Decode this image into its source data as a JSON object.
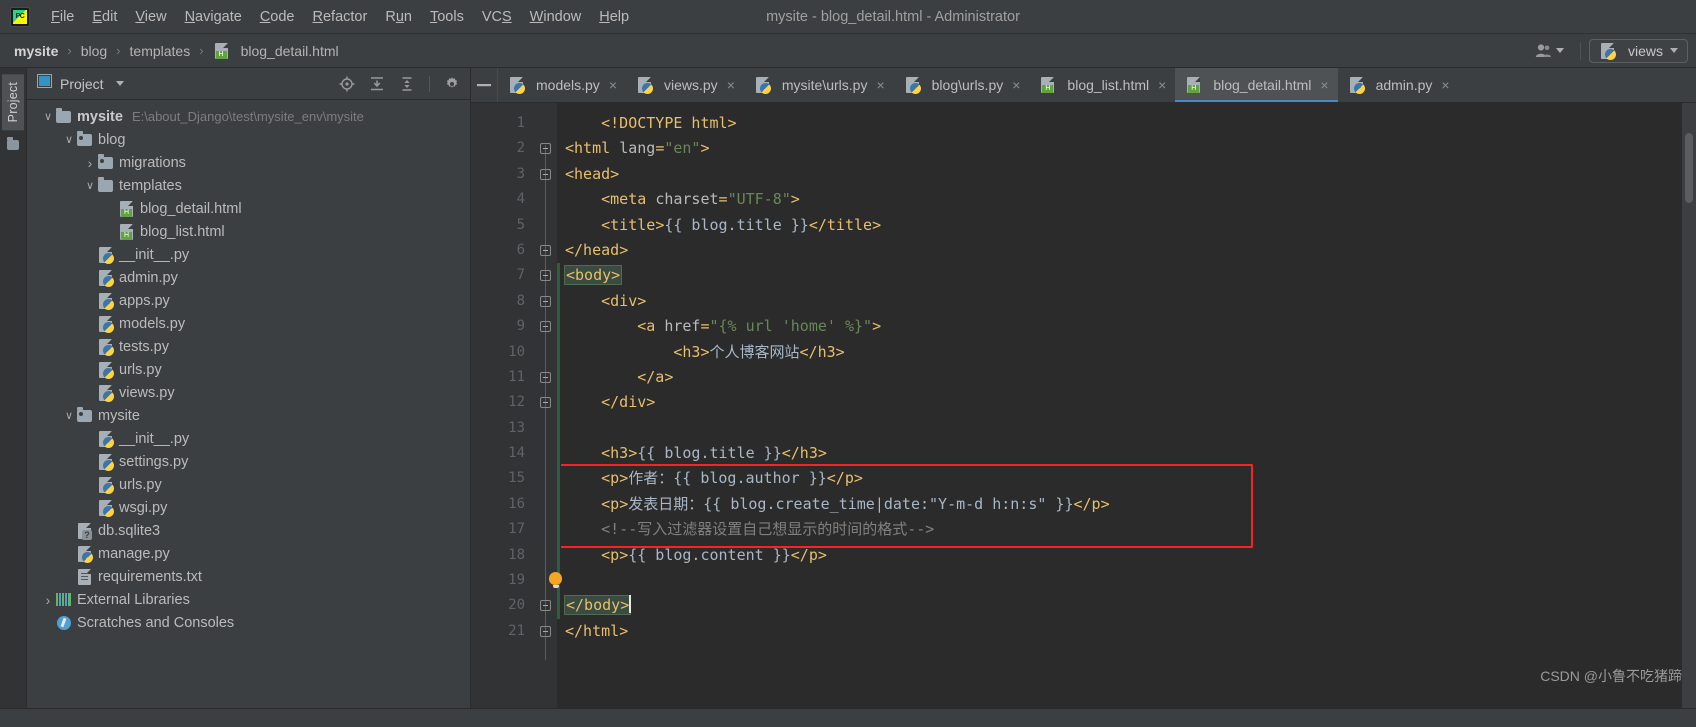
{
  "window": {
    "title": "mysite - blog_detail.html - Administrator",
    "logo_text": "PC"
  },
  "menu": {
    "items": [
      {
        "label": "File",
        "mnemonic": "F"
      },
      {
        "label": "Edit",
        "mnemonic": "E"
      },
      {
        "label": "View",
        "mnemonic": "V"
      },
      {
        "label": "Navigate",
        "mnemonic": "N"
      },
      {
        "label": "Code",
        "mnemonic": "C"
      },
      {
        "label": "Refactor",
        "mnemonic": "R"
      },
      {
        "label": "Run",
        "mnemonic": "u"
      },
      {
        "label": "Tools",
        "mnemonic": "T"
      },
      {
        "label": "VCS",
        "mnemonic": "S"
      },
      {
        "label": "Window",
        "mnemonic": "W"
      },
      {
        "label": "Help",
        "mnemonic": "H"
      }
    ]
  },
  "breadcrumb": {
    "separator": "›",
    "items": [
      "mysite",
      "blog",
      "templates",
      "blog_detail.html"
    ]
  },
  "navbar_right": {
    "user_icon": "user-icon",
    "run_config": "views"
  },
  "left_rail": {
    "tab": "Project"
  },
  "project_panel": {
    "title": "Project",
    "tools": [
      "locate-icon",
      "expand-all-icon",
      "collapse-all-icon",
      "gear-icon",
      "hide-icon"
    ],
    "tree": [
      {
        "depth": 0,
        "arrow": "down",
        "icon": "folder",
        "label": "mysite",
        "bold": true,
        "sub": "E:\\about_Django\\test\\mysite_env\\mysite"
      },
      {
        "depth": 1,
        "arrow": "down",
        "icon": "folder-src",
        "label": "blog",
        "bold": false,
        "sub": ""
      },
      {
        "depth": 2,
        "arrow": "right",
        "icon": "folder-src",
        "label": "migrations",
        "bold": false,
        "sub": ""
      },
      {
        "depth": 2,
        "arrow": "down",
        "icon": "folder",
        "label": "templates",
        "bold": false,
        "sub": ""
      },
      {
        "depth": 3,
        "arrow": "none",
        "icon": "html",
        "label": "blog_detail.html",
        "bold": false,
        "sub": ""
      },
      {
        "depth": 3,
        "arrow": "none",
        "icon": "html",
        "label": "blog_list.html",
        "bold": false,
        "sub": ""
      },
      {
        "depth": 2,
        "arrow": "none",
        "icon": "py",
        "label": "__init__.py",
        "bold": false,
        "sub": ""
      },
      {
        "depth": 2,
        "arrow": "none",
        "icon": "py",
        "label": "admin.py",
        "bold": false,
        "sub": ""
      },
      {
        "depth": 2,
        "arrow": "none",
        "icon": "py",
        "label": "apps.py",
        "bold": false,
        "sub": ""
      },
      {
        "depth": 2,
        "arrow": "none",
        "icon": "py",
        "label": "models.py",
        "bold": false,
        "sub": ""
      },
      {
        "depth": 2,
        "arrow": "none",
        "icon": "py",
        "label": "tests.py",
        "bold": false,
        "sub": ""
      },
      {
        "depth": 2,
        "arrow": "none",
        "icon": "py",
        "label": "urls.py",
        "bold": false,
        "sub": ""
      },
      {
        "depth": 2,
        "arrow": "none",
        "icon": "py",
        "label": "views.py",
        "bold": false,
        "sub": ""
      },
      {
        "depth": 1,
        "arrow": "down",
        "icon": "folder-src",
        "label": "mysite",
        "bold": false,
        "sub": ""
      },
      {
        "depth": 2,
        "arrow": "none",
        "icon": "py",
        "label": "__init__.py",
        "bold": false,
        "sub": ""
      },
      {
        "depth": 2,
        "arrow": "none",
        "icon": "py",
        "label": "settings.py",
        "bold": false,
        "sub": ""
      },
      {
        "depth": 2,
        "arrow": "none",
        "icon": "py",
        "label": "urls.py",
        "bold": false,
        "sub": ""
      },
      {
        "depth": 2,
        "arrow": "none",
        "icon": "py",
        "label": "wsgi.py",
        "bold": false,
        "sub": ""
      },
      {
        "depth": 1,
        "arrow": "none",
        "icon": "db",
        "label": "db.sqlite3",
        "bold": false,
        "sub": ""
      },
      {
        "depth": 1,
        "arrow": "none",
        "icon": "py",
        "label": "manage.py",
        "bold": false,
        "sub": ""
      },
      {
        "depth": 1,
        "arrow": "none",
        "icon": "txt",
        "label": "requirements.txt",
        "bold": false,
        "sub": ""
      },
      {
        "depth": 0,
        "arrow": "right",
        "icon": "lib",
        "label": "External Libraries",
        "bold": false,
        "sub": ""
      },
      {
        "depth": 0,
        "arrow": "none",
        "icon": "scratch",
        "label": "Scratches and Consoles",
        "bold": false,
        "sub": ""
      }
    ]
  },
  "editor": {
    "tabs": [
      {
        "label": "models.py",
        "icon": "py",
        "active": false
      },
      {
        "label": "views.py",
        "icon": "py",
        "active": false
      },
      {
        "label": "mysite\\urls.py",
        "icon": "py",
        "active": false
      },
      {
        "label": "blog\\urls.py",
        "icon": "py",
        "active": false
      },
      {
        "label": "blog_list.html",
        "icon": "html",
        "active": false
      },
      {
        "label": "blog_detail.html",
        "icon": "html",
        "active": true
      },
      {
        "label": "admin.py",
        "icon": "py",
        "active": false
      }
    ],
    "close_glyph": "×",
    "line_numbers": [
      1,
      2,
      3,
      4,
      5,
      6,
      7,
      8,
      9,
      10,
      11,
      12,
      13,
      14,
      15,
      16,
      17,
      18,
      19,
      20,
      21
    ],
    "code_lines": [
      {
        "n": 1,
        "text": "    <!DOCTYPE html>"
      },
      {
        "n": 2,
        "text": "<html lang=\"en\">"
      },
      {
        "n": 3,
        "text": "<head>"
      },
      {
        "n": 4,
        "text": "    <meta charset=\"UTF-8\">"
      },
      {
        "n": 5,
        "text": "    <title>{{ blog.title }}</title>"
      },
      {
        "n": 6,
        "text": "</head>"
      },
      {
        "n": 7,
        "text": "<body>"
      },
      {
        "n": 8,
        "text": "    <div>"
      },
      {
        "n": 9,
        "text": "        <a href=\"{% url 'home' %}\">"
      },
      {
        "n": 10,
        "text": "            <h3>个人博客网站</h3>"
      },
      {
        "n": 11,
        "text": "        </a>"
      },
      {
        "n": 12,
        "text": "    </div>"
      },
      {
        "n": 13,
        "text": ""
      },
      {
        "n": 14,
        "text": "    <h3>{{ blog.title }}</h3>"
      },
      {
        "n": 15,
        "text": "    <p>作者：{{ blog.author }}</p>"
      },
      {
        "n": 16,
        "text": "    <p>发表日期：{{ blog.create_time|date:\"Y-m-d h:n:s\" }}</p>"
      },
      {
        "n": 17,
        "text": "    <!--写入过滤器设置自己想显示的时间的格式-->"
      },
      {
        "n": 18,
        "text": "    <p>{{ blog.content }}</p>"
      },
      {
        "n": 19,
        "text": ""
      },
      {
        "n": 20,
        "text": "</body>"
      },
      {
        "n": 21,
        "text": "</html>"
      }
    ],
    "annotation": {
      "type": "red-rectangle",
      "covers_lines": [
        15,
        16,
        17
      ]
    },
    "intention_bulb_line": 19,
    "caret_line": 20,
    "selected_text": "</body>"
  },
  "watermark": {
    "text": "CSDN @小鲁不吃猪蹄"
  },
  "colors": {
    "panel_bg": "#3c3f41",
    "editor_bg": "#2b2b2b",
    "gutter_bg": "#313335",
    "tag": "#e8bf6a",
    "string": "#6a8759",
    "comment": "#808080",
    "text": "#a9b7c6",
    "accent": "#4a88c7",
    "annotation_red": "#fa2222"
  }
}
